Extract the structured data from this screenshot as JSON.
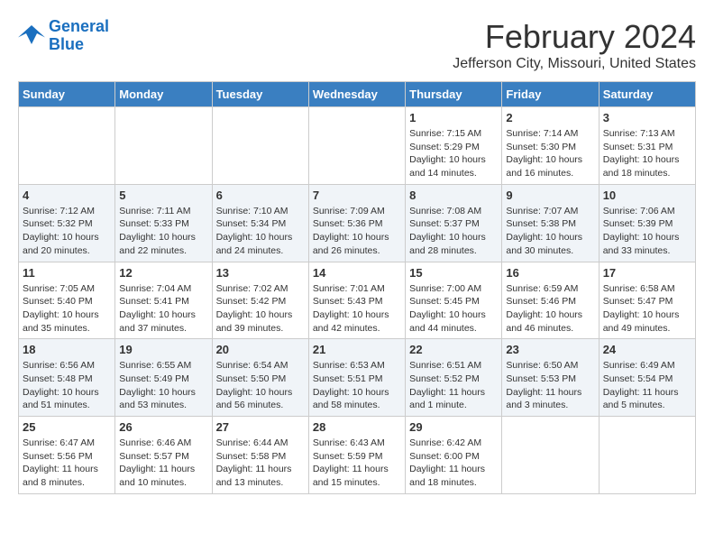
{
  "header": {
    "logo_line1": "General",
    "logo_line2": "Blue",
    "month": "February 2024",
    "location": "Jefferson City, Missouri, United States"
  },
  "weekdays": [
    "Sunday",
    "Monday",
    "Tuesday",
    "Wednesday",
    "Thursday",
    "Friday",
    "Saturday"
  ],
  "weeks": [
    [
      {
        "day": "",
        "info": ""
      },
      {
        "day": "",
        "info": ""
      },
      {
        "day": "",
        "info": ""
      },
      {
        "day": "",
        "info": ""
      },
      {
        "day": "1",
        "info": "Sunrise: 7:15 AM\nSunset: 5:29 PM\nDaylight: 10 hours\nand 14 minutes."
      },
      {
        "day": "2",
        "info": "Sunrise: 7:14 AM\nSunset: 5:30 PM\nDaylight: 10 hours\nand 16 minutes."
      },
      {
        "day": "3",
        "info": "Sunrise: 7:13 AM\nSunset: 5:31 PM\nDaylight: 10 hours\nand 18 minutes."
      }
    ],
    [
      {
        "day": "4",
        "info": "Sunrise: 7:12 AM\nSunset: 5:32 PM\nDaylight: 10 hours\nand 20 minutes."
      },
      {
        "day": "5",
        "info": "Sunrise: 7:11 AM\nSunset: 5:33 PM\nDaylight: 10 hours\nand 22 minutes."
      },
      {
        "day": "6",
        "info": "Sunrise: 7:10 AM\nSunset: 5:34 PM\nDaylight: 10 hours\nand 24 minutes."
      },
      {
        "day": "7",
        "info": "Sunrise: 7:09 AM\nSunset: 5:36 PM\nDaylight: 10 hours\nand 26 minutes."
      },
      {
        "day": "8",
        "info": "Sunrise: 7:08 AM\nSunset: 5:37 PM\nDaylight: 10 hours\nand 28 minutes."
      },
      {
        "day": "9",
        "info": "Sunrise: 7:07 AM\nSunset: 5:38 PM\nDaylight: 10 hours\nand 30 minutes."
      },
      {
        "day": "10",
        "info": "Sunrise: 7:06 AM\nSunset: 5:39 PM\nDaylight: 10 hours\nand 33 minutes."
      }
    ],
    [
      {
        "day": "11",
        "info": "Sunrise: 7:05 AM\nSunset: 5:40 PM\nDaylight: 10 hours\nand 35 minutes."
      },
      {
        "day": "12",
        "info": "Sunrise: 7:04 AM\nSunset: 5:41 PM\nDaylight: 10 hours\nand 37 minutes."
      },
      {
        "day": "13",
        "info": "Sunrise: 7:02 AM\nSunset: 5:42 PM\nDaylight: 10 hours\nand 39 minutes."
      },
      {
        "day": "14",
        "info": "Sunrise: 7:01 AM\nSunset: 5:43 PM\nDaylight: 10 hours\nand 42 minutes."
      },
      {
        "day": "15",
        "info": "Sunrise: 7:00 AM\nSunset: 5:45 PM\nDaylight: 10 hours\nand 44 minutes."
      },
      {
        "day": "16",
        "info": "Sunrise: 6:59 AM\nSunset: 5:46 PM\nDaylight: 10 hours\nand 46 minutes."
      },
      {
        "day": "17",
        "info": "Sunrise: 6:58 AM\nSunset: 5:47 PM\nDaylight: 10 hours\nand 49 minutes."
      }
    ],
    [
      {
        "day": "18",
        "info": "Sunrise: 6:56 AM\nSunset: 5:48 PM\nDaylight: 10 hours\nand 51 minutes."
      },
      {
        "day": "19",
        "info": "Sunrise: 6:55 AM\nSunset: 5:49 PM\nDaylight: 10 hours\nand 53 minutes."
      },
      {
        "day": "20",
        "info": "Sunrise: 6:54 AM\nSunset: 5:50 PM\nDaylight: 10 hours\nand 56 minutes."
      },
      {
        "day": "21",
        "info": "Sunrise: 6:53 AM\nSunset: 5:51 PM\nDaylight: 10 hours\nand 58 minutes."
      },
      {
        "day": "22",
        "info": "Sunrise: 6:51 AM\nSunset: 5:52 PM\nDaylight: 11 hours\nand 1 minute."
      },
      {
        "day": "23",
        "info": "Sunrise: 6:50 AM\nSunset: 5:53 PM\nDaylight: 11 hours\nand 3 minutes."
      },
      {
        "day": "24",
        "info": "Sunrise: 6:49 AM\nSunset: 5:54 PM\nDaylight: 11 hours\nand 5 minutes."
      }
    ],
    [
      {
        "day": "25",
        "info": "Sunrise: 6:47 AM\nSunset: 5:56 PM\nDaylight: 11 hours\nand 8 minutes."
      },
      {
        "day": "26",
        "info": "Sunrise: 6:46 AM\nSunset: 5:57 PM\nDaylight: 11 hours\nand 10 minutes."
      },
      {
        "day": "27",
        "info": "Sunrise: 6:44 AM\nSunset: 5:58 PM\nDaylight: 11 hours\nand 13 minutes."
      },
      {
        "day": "28",
        "info": "Sunrise: 6:43 AM\nSunset: 5:59 PM\nDaylight: 11 hours\nand 15 minutes."
      },
      {
        "day": "29",
        "info": "Sunrise: 6:42 AM\nSunset: 6:00 PM\nDaylight: 11 hours\nand 18 minutes."
      },
      {
        "day": "",
        "info": ""
      },
      {
        "day": "",
        "info": ""
      }
    ]
  ]
}
